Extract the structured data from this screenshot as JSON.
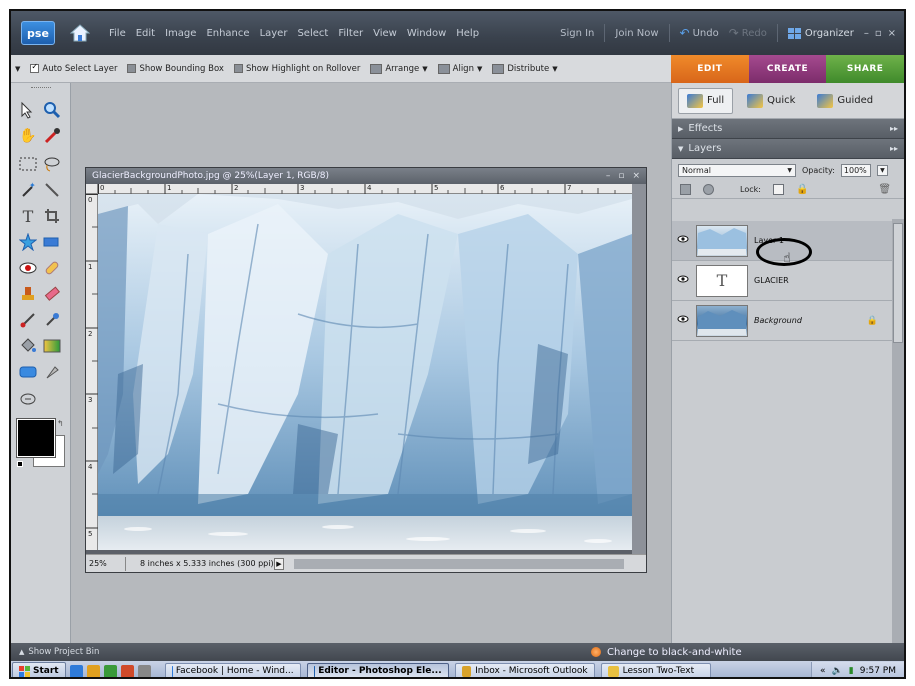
{
  "menubar": {
    "logo": "pse",
    "items": [
      "File",
      "Edit",
      "Image",
      "Enhance",
      "Layer",
      "Select",
      "Filter",
      "View",
      "Window",
      "Help"
    ],
    "sign_in": "Sign In",
    "join_now": "Join Now",
    "undo": "Undo",
    "redo": "Redo",
    "organizer": "Organizer",
    "minimize": "–",
    "restore": "▫",
    "close": "×"
  },
  "options": {
    "auto_select": "Auto Select Layer",
    "bounding_box": "Show Bounding Box",
    "highlight": "Show Highlight on Rollover",
    "arrange": "Arrange",
    "align": "Align",
    "distribute": "Distribute"
  },
  "mode_tabs": {
    "edit": "EDIT",
    "create": "CREATE",
    "share": "SHARE",
    "colors": {
      "edit": "#e8791f",
      "create": "#94397f",
      "share": "#579e38"
    }
  },
  "document": {
    "title": "GlacierBackgroundPhoto.jpg @ 25%(Layer 1, RGB/8)",
    "zoom": "25%",
    "info": "8 inches x 5.333 inches (300 ppi)",
    "ruler_top_labels": [
      "0",
      "1",
      "2",
      "3",
      "4",
      "5",
      "6",
      "7"
    ],
    "ruler_left_labels": [
      "0",
      "1",
      "2",
      "3",
      "4",
      "5"
    ]
  },
  "palette": {
    "edit_modes": {
      "full": "Full",
      "quick": "Quick",
      "guided": "Guided"
    },
    "effects": "Effects",
    "layers": "Layers",
    "blend_mode": "Normal",
    "opacity_label": "Opacity:",
    "opacity_value": "100%",
    "lock_label": "Lock:",
    "layers_list": [
      {
        "name": "Layer 1",
        "italic": false
      },
      {
        "name": "GLACIER",
        "italic": false
      },
      {
        "name": "Background",
        "italic": true
      }
    ]
  },
  "bottombar": {
    "project_bin": "Show Project Bin",
    "action_hint": "Change to black-and-white"
  },
  "taskbar": {
    "start": "Start",
    "tasks": [
      "Facebook | Home - Wind...",
      "Editor - Photoshop Ele...",
      "Inbox - Microsoft Outlook",
      "Lesson Two-Text"
    ],
    "clock": "9:57 PM"
  }
}
